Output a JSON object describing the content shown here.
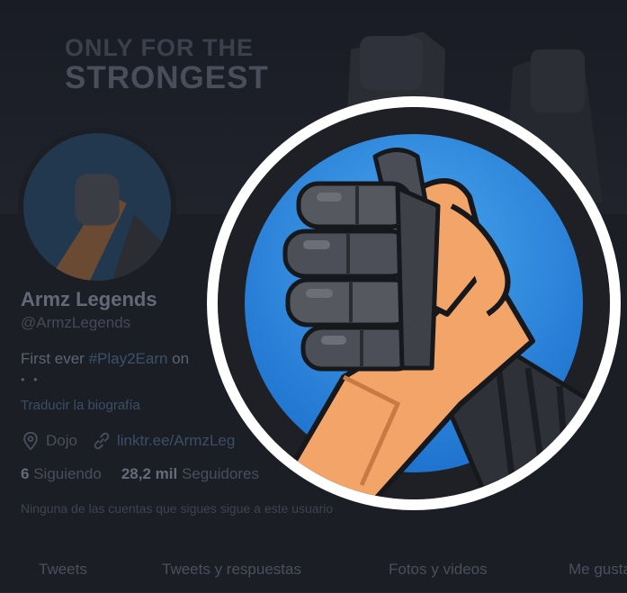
{
  "banner": {
    "line1": "ONLY FOR THE",
    "line2": "STRONGEST"
  },
  "profile": {
    "display_name": "Armz Legends",
    "handle": "@ArmzLegends",
    "bio_start": "First ever ",
    "bio_hashtag": "#Play2Earn",
    "bio_rest": " on",
    "bio_extra": "• •",
    "translate_label": "Traducir la biografía",
    "location": "Dojo",
    "link": "linktr.ee/ArmzLeg",
    "following_count": "6",
    "following_label": "Siguiendo",
    "followers_count": "28,2 mil",
    "followers_label": "Seguidores",
    "follow_note": "Ninguna de las cuentas que sigues sigue a este usuario"
  },
  "tabs": [
    {
      "label": "Tweets"
    },
    {
      "label": "Tweets y respuestas"
    },
    {
      "label": "Fotos y videos"
    },
    {
      "label": "Me gusta"
    }
  ],
  "icons": {
    "location": "location-pin-icon",
    "link": "link-icon"
  },
  "colors": {
    "avatar_blue": "#2f8fe3",
    "skin": "#f3a468",
    "robot": "#3c3f48"
  }
}
